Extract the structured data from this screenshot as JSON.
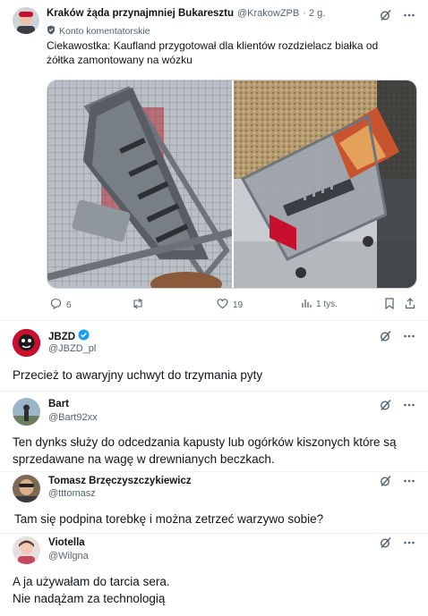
{
  "post1": {
    "author_name": "Kraków żąda przynajmniej Bukaresztu",
    "handle": "@KrakowZPB",
    "time": "· 2 g.",
    "badge": "Konto komentatorskie",
    "text_line1": "Ciekawostka: Kaufland przygotował dla klientów rozdzielacz białka od",
    "text_line2": "żółtka zamontowany na wózku",
    "stats": {
      "replies": "6",
      "reposts": "",
      "likes": "19",
      "views": "1 tys."
    }
  },
  "reply1": {
    "author_name": "JBZD",
    "handle": "@JBZD_pl",
    "verified": true,
    "text": "Przecież to awaryjny uchwyt do trzymania pyty"
  },
  "reply2": {
    "author_name": "Bart",
    "handle": "@Bart92xx",
    "text_line1": "Ten dynks służy do odcedzania kapusty lub ogórków kiszonych które są",
    "text_line2": "sprzedawane na wagę w drewnianych beczkach."
  },
  "reply3": {
    "author_name": "Tomasz Brzęczyszczykiewicz",
    "handle": "@tttomasz",
    "text": "Tam się podpina torebkę i można zetrzeć warzywo sobie?"
  },
  "reply4": {
    "author_name": "Viotella",
    "handle": "@Wilgna",
    "text_line1": "A ja używałam do tarcia sera.",
    "text_line2": "Nie nadążam za technologią"
  },
  "colors": {
    "text": "#0f1419",
    "secondary": "#536471",
    "divider": "#eff3f4",
    "verified": "#1d9bf0",
    "jbzd_red": "#c8102e"
  },
  "icons": [
    "grok-icon",
    "more-icon",
    "reply-icon",
    "repost-icon",
    "like-icon",
    "views-icon",
    "bookmark-icon",
    "share-icon",
    "verified-icon",
    "shield-icon"
  ]
}
